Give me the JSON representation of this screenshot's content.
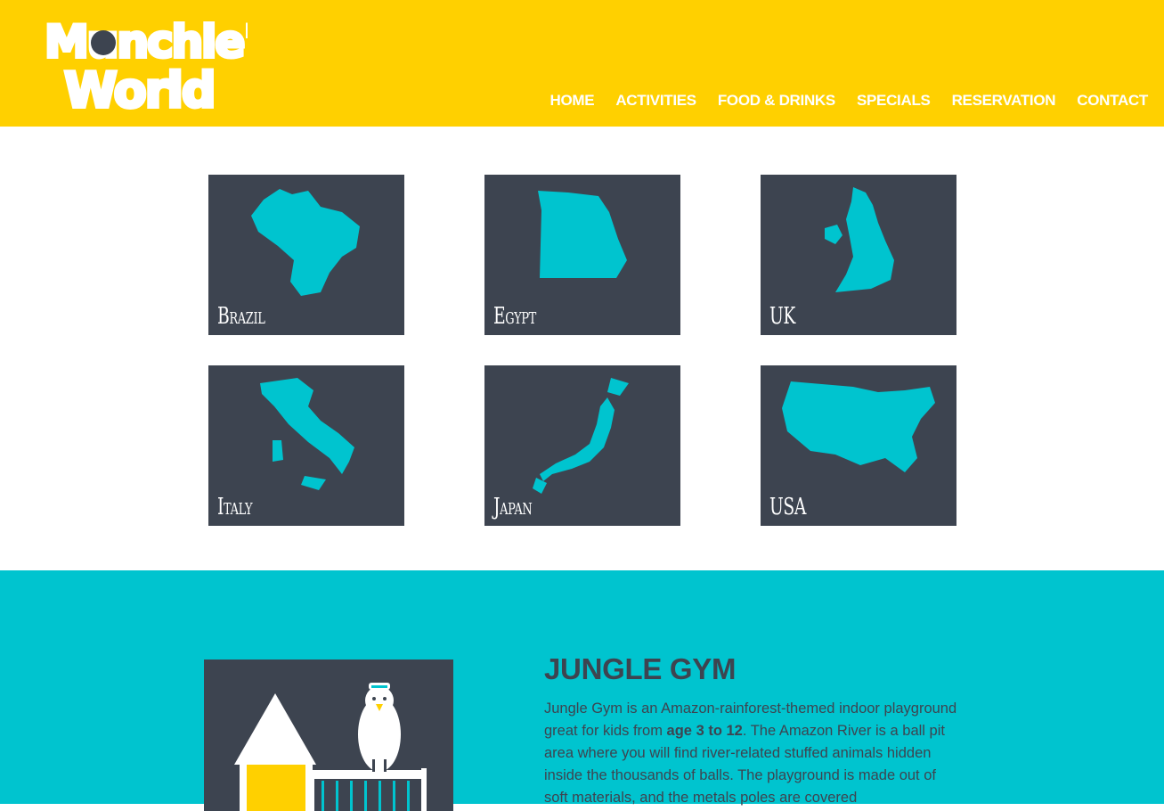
{
  "brand": {
    "logo_text_line1": "Munchie's",
    "logo_text_line2": "World"
  },
  "nav": {
    "items": [
      {
        "label": "HOME"
      },
      {
        "label": "ACTIVITIES"
      },
      {
        "label": "FOOD & DRINKS"
      },
      {
        "label": "SPECIALS"
      },
      {
        "label": "RESERVATION"
      },
      {
        "label": "CONTACT"
      }
    ]
  },
  "countries": [
    {
      "name": "Brazil"
    },
    {
      "name": "Egypt"
    },
    {
      "name": "UK"
    },
    {
      "name": "Italy"
    },
    {
      "name": "Japan"
    },
    {
      "name": "USA"
    }
  ],
  "jungle_gym": {
    "title": "JUNGLE GYM",
    "text_1": "Jungle Gym is an Amazon-rainforest-themed indoor playground great for kids from ",
    "age_range": "age 3 to 12",
    "text_2": ". The Amazon River is a ball pit area where you will find river-related stuffed animals hidden inside the thousands of balls. The playground is made out of soft materials, and the metals poles are covered"
  },
  "colors": {
    "header_yellow": "#ffd000",
    "teal": "#00c4cf",
    "tile_dark": "#3d4450",
    "map_fill": "#00c4cf"
  }
}
